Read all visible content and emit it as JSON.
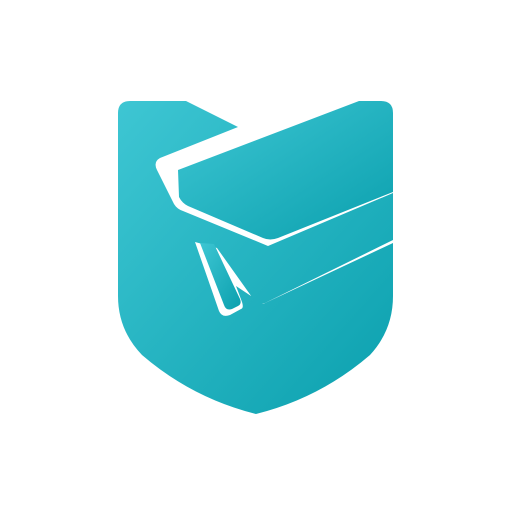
{
  "icon": {
    "name": "shield-security-camera-icon",
    "background_color": "#ffffff",
    "gradient": {
      "start": "#3ec6d3",
      "end": "#0ba0ae"
    },
    "cutout_color": "#ffffff"
  }
}
